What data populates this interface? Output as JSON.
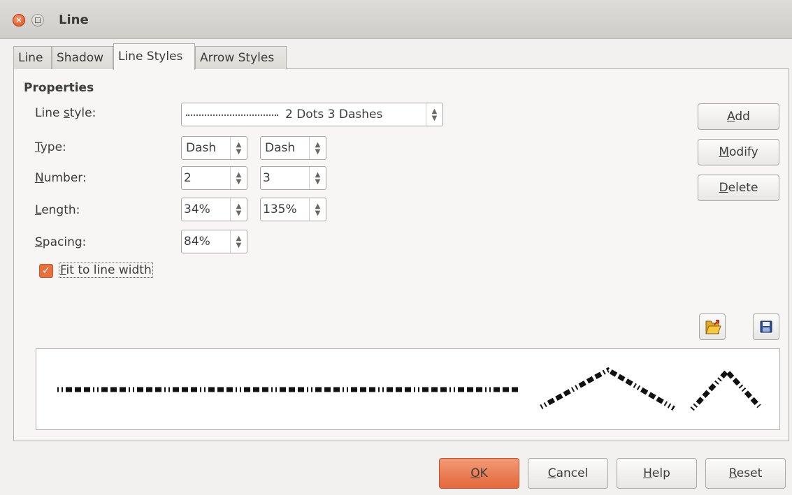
{
  "window": {
    "title": "Line"
  },
  "tabs": [
    {
      "label": "Line"
    },
    {
      "label": "Shadow"
    },
    {
      "label": "Line Styles"
    },
    {
      "label": "Arrow Styles"
    }
  ],
  "active_tab": "Line Styles",
  "properties": {
    "title": "Properties",
    "line_style": {
      "label": "Line style:",
      "value": "2 Dots 3 Dashes"
    },
    "type": {
      "label": "Type:",
      "value1": "Dash",
      "value2": "Dash"
    },
    "number": {
      "label": "Number:",
      "value1": "2",
      "value2": "3"
    },
    "length": {
      "label": "Length:",
      "value1": "34%",
      "value2": "135%"
    },
    "spacing": {
      "label": "Spacing:",
      "value": "84%"
    },
    "fit_to_line_width": {
      "label": "Fit to line width",
      "checked": true
    }
  },
  "side_buttons": {
    "add": "Add",
    "modify": "Modify",
    "delete": "Delete"
  },
  "icons": {
    "load": "folder-open-icon",
    "save": "floppy-disk-save-icon"
  },
  "bottom_buttons": {
    "ok": "OK",
    "cancel": "Cancel",
    "help": "Help",
    "reset": "Reset"
  },
  "colors": {
    "accent": "#e4673b",
    "check": "#e6713f"
  }
}
